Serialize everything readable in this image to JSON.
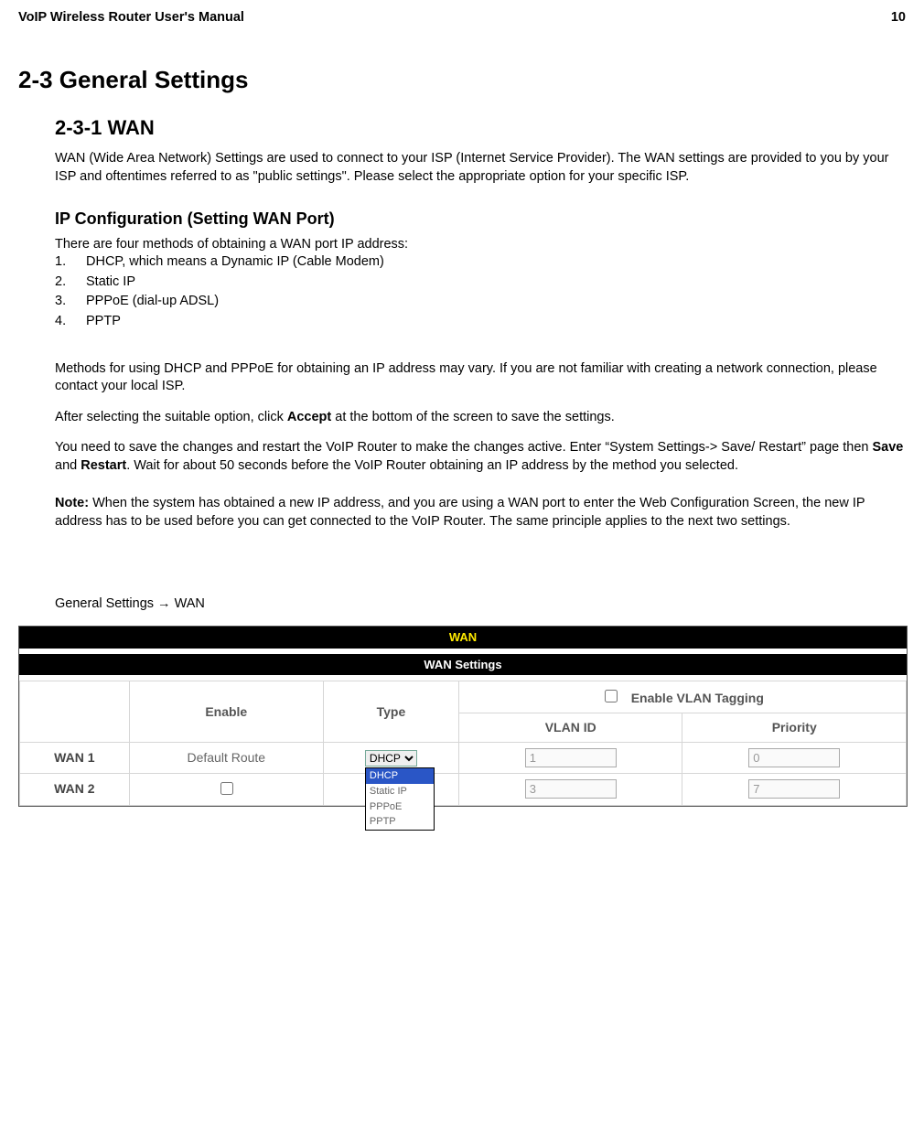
{
  "header": {
    "doc_title": "VoIP Wireless Router User's Manual",
    "page_no": "10"
  },
  "h1": "2-3 General Settings",
  "h2": "2-3-1 WAN",
  "p_wan_intro": "WAN (Wide Area Network) Settings are used to connect to your ISP (Internet Service Provider). The WAN settings are provided to you by your ISP and oftentimes referred to as \"public settings\". Please select the appropriate option for your specific ISP.",
  "h3_ipcfg": "IP Configuration (Setting WAN Port)",
  "p_methods_intro": "There are four methods of obtaining a WAN port IP address:",
  "methods": [
    "DHCP, which means a Dynamic IP (Cable Modem)",
    "Static IP",
    "PPPoE (dial-up ADSL)",
    "PPTP"
  ],
  "p_methods_note": "Methods for using DHCP and PPPoE for obtaining an IP address may vary. If you are not familiar with creating a network connection, please contact your local ISP.",
  "p_accept_pre": "After selecting the suitable option, click ",
  "p_accept_bold": "Accept",
  "p_accept_post": " at the bottom of the screen to save the settings.",
  "p_save_pre": "You need to save the changes and restart the VoIP Router to make the changes active. Enter “System Settings-> Save/ Restart” page then ",
  "p_save_b1": "Save",
  "p_save_mid": " and ",
  "p_save_b2": "Restart",
  "p_save_post": ". Wait for about 50 seconds before the VoIP Router obtaining an IP address by the method you selected.",
  "p_note_label": "Note:",
  "p_note_body": " When the system has obtained a new IP address, and you are using a WAN port to enter the Web Configuration Screen, the new IP address has to be used before you can get connected to the VoIP Router. The same principle applies to the next two settings.",
  "p_path": "General Settings → WAN",
  "screenshot": {
    "title_bar": "WAN",
    "subtitle_bar": "WAN Settings",
    "cols": {
      "blank": "",
      "enable": "Enable",
      "type": "Type",
      "vlan_group": "Enable VLAN Tagging",
      "vlan_id": "VLAN ID",
      "priority": "Priority"
    },
    "rows": [
      {
        "name": "WAN 1",
        "enable_text": "Default Route",
        "type_selected": "DHCP",
        "vlan_id": "1",
        "priority": "0"
      },
      {
        "name": "WAN 2",
        "enable_text": "",
        "type_selected": "",
        "vlan_id": "3",
        "priority": "7"
      }
    ],
    "type_options": [
      "DHCP",
      "Static IP",
      "PPPoE",
      "PPTP"
    ]
  }
}
